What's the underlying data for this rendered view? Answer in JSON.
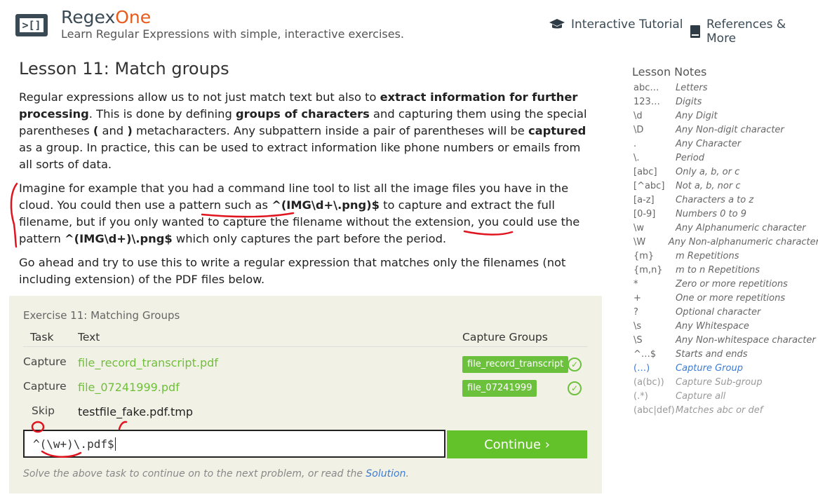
{
  "header": {
    "logo_text": ">[]",
    "brand_part1": "Regex",
    "brand_part2": "One",
    "subtitle": "Learn Regular Expressions with simple, interactive exercises.",
    "nav": [
      {
        "label": "Interactive Tutorial",
        "icon": "graduation-cap-icon"
      },
      {
        "label": "References & More",
        "icon": "book-icon"
      }
    ]
  },
  "lesson": {
    "title": "Lesson 11: Match groups",
    "p1": {
      "t1": "Regular expressions allow us to not just match text but also to ",
      "b1": "extract information for further processing",
      "t2": ". This is done by defining ",
      "b2": "groups of characters",
      "t3": " and capturing them using the special parentheses ",
      "b3": "(",
      "t4": " and ",
      "b4": ")",
      "t5": " metacharacters. Any subpattern inside a pair of parentheses will be ",
      "b5": "captured",
      "t6": " as a group. In practice, this can be used to extract information like phone numbers or emails from all sorts of data."
    },
    "p2": {
      "t1": "Imagine for example that you had a command line tool to list all the image files you have in the cloud. You could then use a pattern such as ",
      "c1": "^(IMG\\d+\\.png)$",
      "t2": " to capture and extract the full filename, but if you only wanted to capture the filename without the extension, you could use the pattern ",
      "c2": "^(IMG\\d+)\\.png$",
      "t3": " which only captures the part before the period."
    },
    "p3": "Go ahead and try to use this to write a regular expression that matches only the filenames (not including extension) of the PDF files below."
  },
  "exercise": {
    "title": "Exercise 11: Matching Groups",
    "headers": {
      "task": "Task",
      "text": "Text",
      "groups": "Capture Groups"
    },
    "rows": [
      {
        "task": "Capture",
        "text": "file_record_transcript.pdf",
        "group": "file_record_transcript",
        "matched": true
      },
      {
        "task": "Capture",
        "text": "file_07241999.pdf",
        "group": "file_07241999",
        "matched": true
      },
      {
        "task": "Skip",
        "text": "testfile_fake.pdf.tmp",
        "group": "",
        "matched": false
      }
    ],
    "input_value": "^(\\w+)\\.pdf$",
    "continue_label": "Continue ›",
    "footer_text": "Solve the above task to continue on to the next problem, or read the ",
    "footer_link": "Solution",
    "footer_end": "."
  },
  "notes": {
    "title": "Lesson Notes",
    "items": [
      {
        "key": "abc…",
        "desc": "Letters"
      },
      {
        "key": "123…",
        "desc": "Digits"
      },
      {
        "key": "\\d",
        "desc": "Any Digit"
      },
      {
        "key": "\\D",
        "desc": "Any Non-digit character"
      },
      {
        "key": ".",
        "desc": "Any Character"
      },
      {
        "key": "\\.",
        "desc": "Period"
      },
      {
        "key": "[abc]",
        "desc": "Only a, b, or c"
      },
      {
        "key": "[^abc]",
        "desc": "Not a, b, nor c"
      },
      {
        "key": "[a-z]",
        "desc": "Characters a to z"
      },
      {
        "key": "[0-9]",
        "desc": "Numbers 0 to 9"
      },
      {
        "key": "\\w",
        "desc": "Any Alphanumeric character"
      },
      {
        "key": "\\W",
        "desc": "Any Non-alphanumeric character"
      },
      {
        "key": "{m}",
        "desc": "m Repetitions"
      },
      {
        "key": "{m,n}",
        "desc": "m to n Repetitions"
      },
      {
        "key": "*",
        "desc": "Zero or more repetitions"
      },
      {
        "key": "+",
        "desc": "One or more repetitions"
      },
      {
        "key": "?",
        "desc": "Optional character"
      },
      {
        "key": "\\s",
        "desc": "Any Whitespace"
      },
      {
        "key": "\\S",
        "desc": "Any Non-whitespace character"
      },
      {
        "key": "^…$",
        "desc": "Starts and ends"
      },
      {
        "key": "(…)",
        "desc": "Capture Group"
      },
      {
        "key": "(a(bc))",
        "desc": "Capture Sub-group"
      },
      {
        "key": "(.*)",
        "desc": "Capture all"
      },
      {
        "key": "(abc|def)",
        "desc": "Matches abc or def"
      }
    ]
  },
  "colors": {
    "accent": "#e85a1c",
    "green": "#63c22a",
    "link": "#3a7bd5",
    "annotation": "#e0141e"
  }
}
